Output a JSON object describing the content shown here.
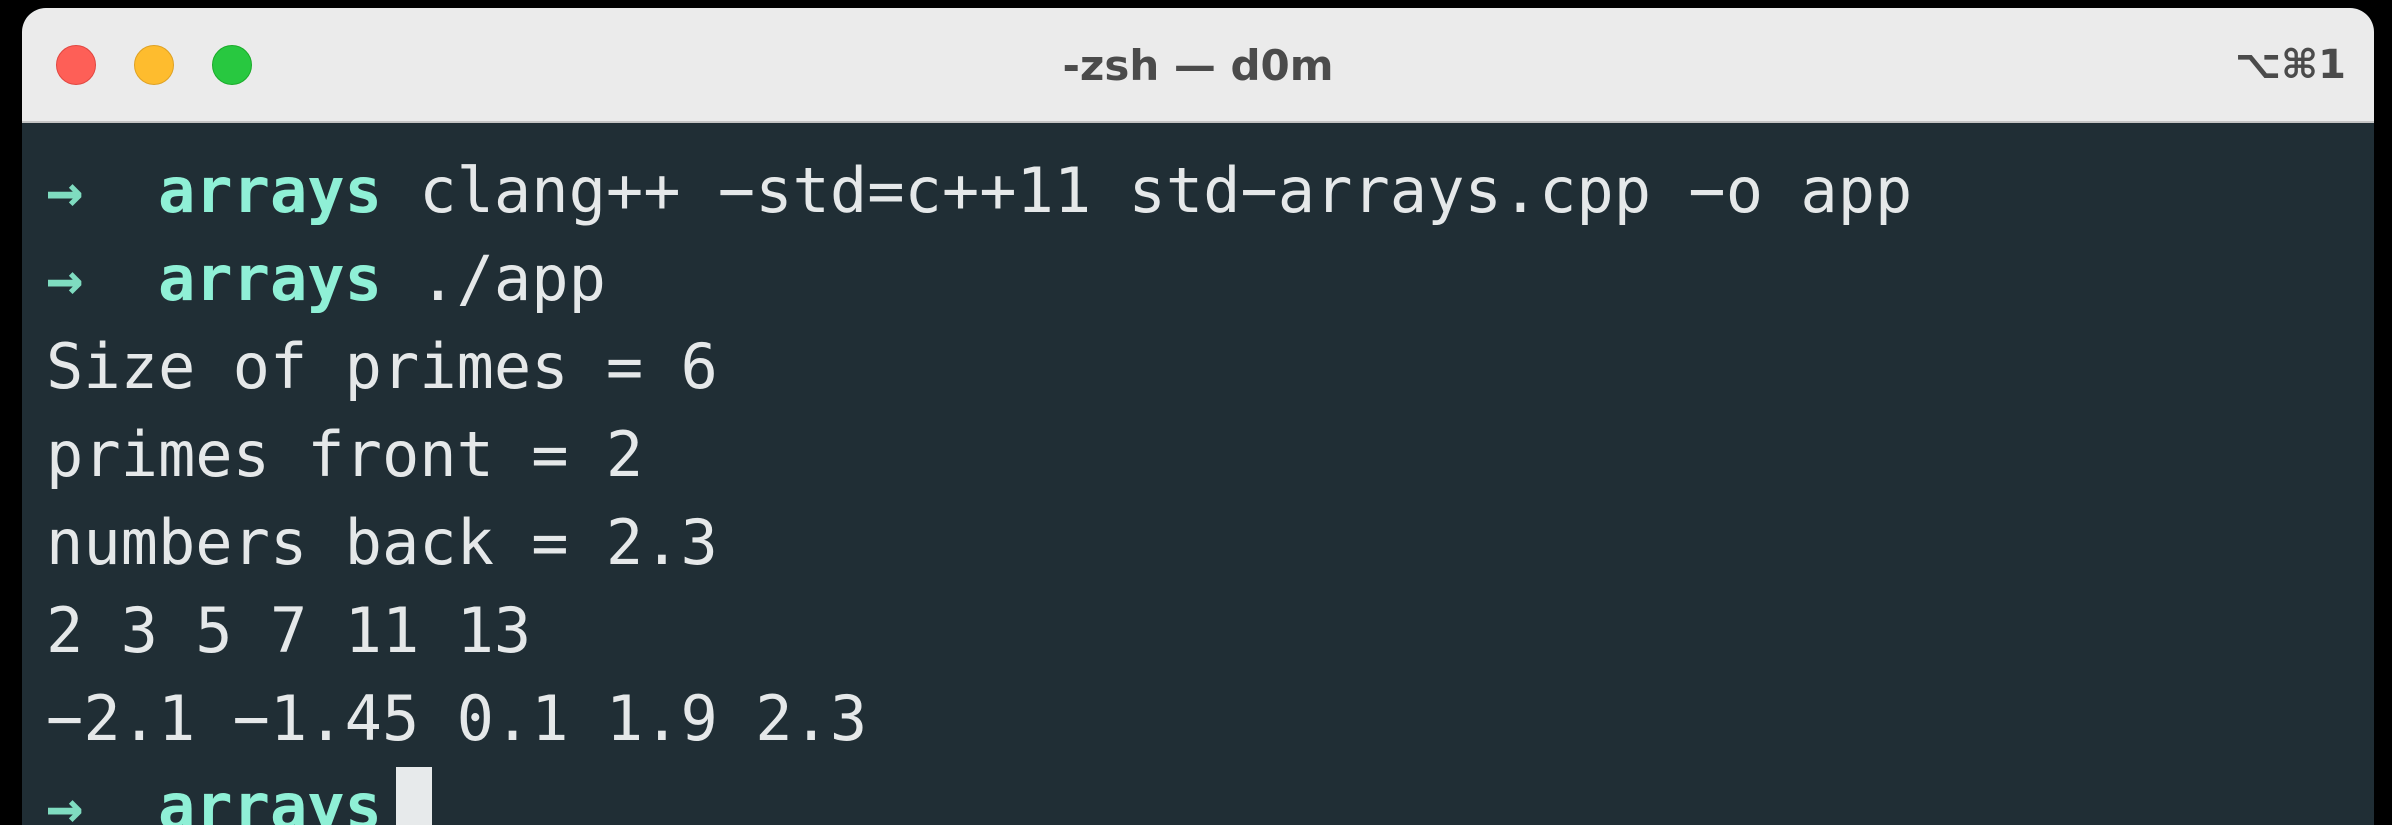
{
  "window": {
    "title": "-zsh — d0m",
    "shortcut": "⌥⌘1"
  },
  "terminal": {
    "prompt_symbol": "→",
    "prompt_lines": [
      {
        "dir": "arrays",
        "command": "clang++ −std=c++11 std−arrays.cpp −o app"
      },
      {
        "dir": "arrays",
        "command": "./app"
      }
    ],
    "output": [
      "Size of primes = 6",
      "primes front = 2",
      "numbers back = 2.3",
      "2 3 5 7 11 13",
      "−2.1 −1.45 0.1 1.9 2.3"
    ],
    "current_prompt": {
      "dir": "arrays"
    }
  },
  "colors": {
    "background": "#202e35",
    "prompt_accent": "#8ff0d6",
    "text": "#e5e8e9",
    "titlebar": "#ebebeb"
  }
}
